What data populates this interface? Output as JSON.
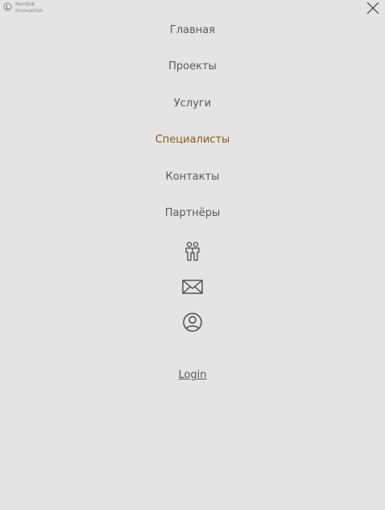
{
  "brand": {
    "logo_line1": "Nordisk",
    "logo_line2": "Innovation"
  },
  "nav": {
    "items": [
      {
        "label": "Главная",
        "active": false
      },
      {
        "label": "Проекты",
        "active": false
      },
      {
        "label": "Услуги",
        "active": false
      },
      {
        "label": "Специалисты",
        "active": true
      },
      {
        "label": "Контакты",
        "active": false
      },
      {
        "label": "Партнёры",
        "active": false
      }
    ],
    "icons": [
      "partners-icon",
      "mail-icon",
      "user-account-icon"
    ],
    "login_label": "Login"
  },
  "colors": {
    "background": "#e4e4e4",
    "text": "#5a5a5a",
    "active": "#8a5a16",
    "icon": "#4a4a4a"
  },
  "close_icon": "close-icon"
}
